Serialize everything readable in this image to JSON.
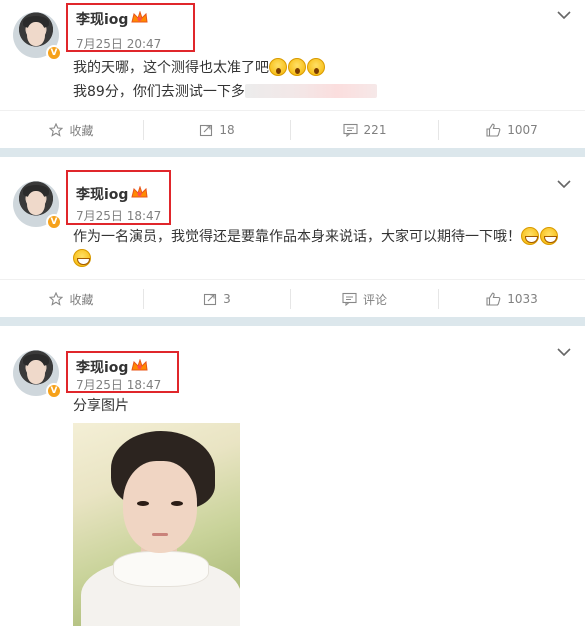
{
  "posts": [
    {
      "author": "李现iog",
      "time": "7月25日 20:47",
      "lines": [
        "我的天哪，这个测得也太准了吧",
        "我89分，你们去测试一下多"
      ],
      "actions": {
        "favorite": "收藏",
        "repost": "18",
        "comment": "221",
        "like": "1007"
      }
    },
    {
      "author": "李现iog",
      "time": "7月25日 18:47",
      "lines": [
        "作为一名演员，我觉得还是要靠作品本身来说话，大家可以期待一下哦！"
      ],
      "actions": {
        "favorite": "收藏",
        "repost": "3",
        "comment": "评论",
        "like": "1033"
      }
    },
    {
      "author": "李现iog",
      "time": "7月25日 18:47",
      "lines": [
        "分享图片"
      ]
    }
  ],
  "icons": {
    "verified": "V",
    "crown": "crown-icon",
    "more": "chevron-down-icon",
    "favorite": "star-icon",
    "repost": "repost-icon",
    "comment": "comment-icon",
    "like": "thumbs-up-icon"
  },
  "colors": {
    "highlight_box": "#e0262b",
    "verified_badge": "#f6a11a",
    "separator": "#dce7ec",
    "muted_text": "#808080"
  }
}
